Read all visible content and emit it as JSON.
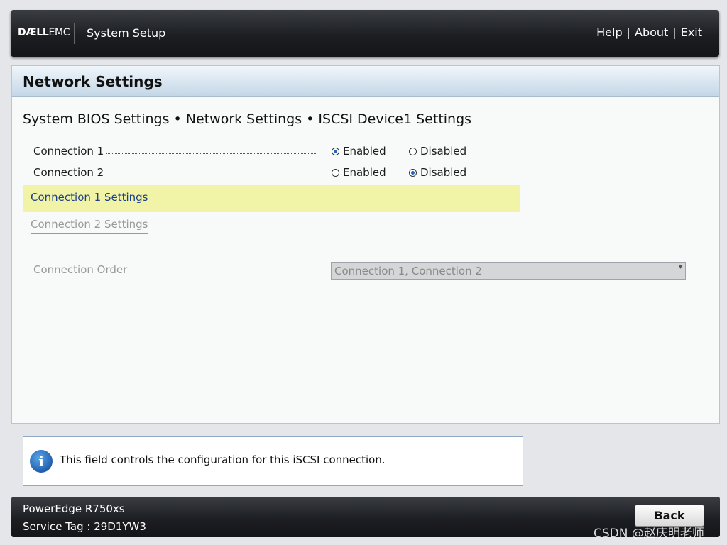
{
  "header": {
    "logo": "DÆLLEMC",
    "logo_main": "DÆLL",
    "logo_suffix": "EMC",
    "title": "System Setup",
    "links": [
      "Help",
      "About",
      "Exit"
    ],
    "separator": "|"
  },
  "panel": {
    "title": "Network Settings",
    "breadcrumb": "System BIOS Settings • Network Settings • ISCSI Device1 Settings"
  },
  "settings": [
    {
      "label": "Connection 1",
      "options": [
        "Enabled",
        "Disabled"
      ],
      "selected": "Enabled"
    },
    {
      "label": "Connection 2",
      "options": [
        "Enabled",
        "Disabled"
      ],
      "selected": "Disabled"
    }
  ],
  "links": [
    {
      "label": "Connection 1 Settings",
      "state": "selected"
    },
    {
      "label": "Connection 2 Settings",
      "state": "disabled"
    }
  ],
  "connection_order": {
    "label": "Connection Order",
    "value": "Connection 1, Connection 2"
  },
  "help": {
    "icon": "info-icon",
    "text": "This field controls the configuration for this iSCSI connection."
  },
  "footer": {
    "model": "PowerEdge R750xs",
    "service_tag": "Service Tag : 29D1YW3",
    "back_label": "Back"
  },
  "watermark": "CSDN @赵庆明老师",
  "colors": {
    "highlight": "#f1f4a6",
    "link": "#1d3f8a",
    "header_bg": "#1c1e22",
    "panel_title_bg": "#c4d7e7"
  }
}
